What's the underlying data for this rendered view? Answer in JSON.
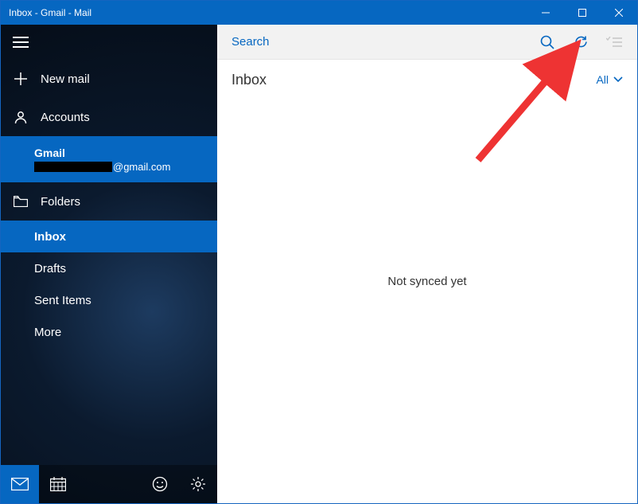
{
  "window": {
    "title": "Inbox - Gmail - Mail"
  },
  "sidebar": {
    "new_mail": "New mail",
    "accounts_label": "Accounts",
    "account": {
      "name": "Gmail",
      "email_suffix": "@gmail.com"
    },
    "folders_label": "Folders",
    "folders": {
      "inbox": "Inbox",
      "drafts": "Drafts",
      "sent": "Sent Items",
      "more": "More"
    }
  },
  "content": {
    "search_placeholder": "Search",
    "header": "Inbox",
    "filter_label": "All",
    "empty_message": "Not synced yet"
  }
}
